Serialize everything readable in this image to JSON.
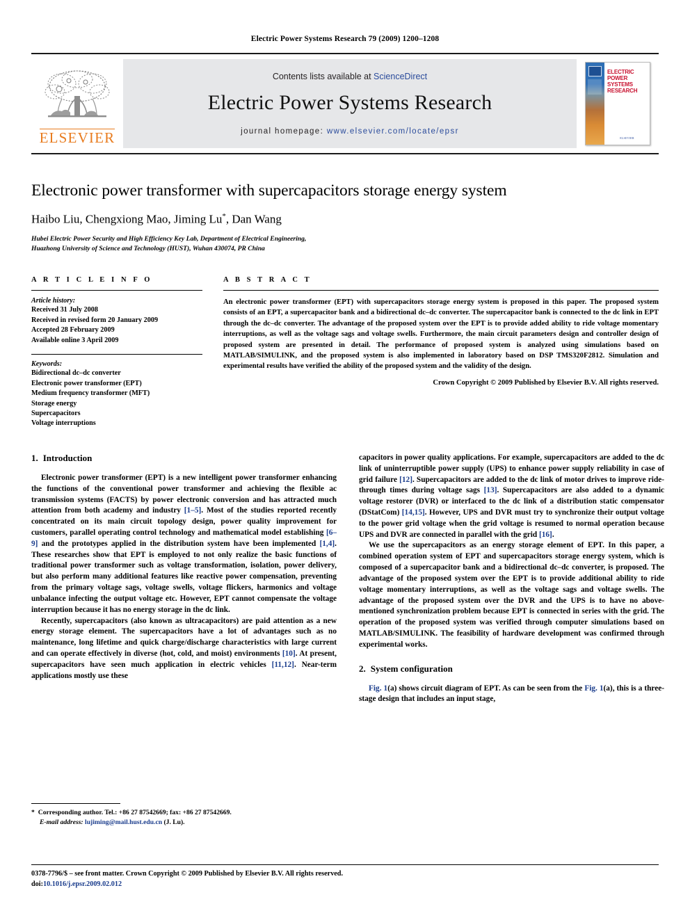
{
  "running_head": "Electric Power Systems Research 79 (2009) 1200–1208",
  "masthead": {
    "contents_prefix": "Contents lists available at ",
    "contents_link": "ScienceDirect",
    "journal_name": "Electric Power Systems Research",
    "homepage_label": "journal homepage:",
    "homepage_url": "www.elsevier.com/locate/epsr",
    "publisher_wordmark": "ELSEVIER",
    "publisher_color": "#E87B1E",
    "link_color": "#2a4b9b",
    "panel_color": "#e6e7e9",
    "cover": {
      "title_line1": "ELECTRIC POWER",
      "title_line2": "SYSTEMS RESEARCH",
      "title_color": "#c8102e",
      "footer_text": "ELSEVIER"
    }
  },
  "article": {
    "title": "Electronic power transformer with supercapacitors storage energy system",
    "authors": "Haibo Liu, Chengxiong Mao, Jiming Lu",
    "authors_suffix": ", Dan Wang",
    "corresponding_marker": "*",
    "affiliation_line1": "Hubei Electric Power Security and High Efficiency Key Lab, Department of Electrical Engineering,",
    "affiliation_line2": "Huazhong University of Science and Technology (HUST), Wuhan 430074, PR China"
  },
  "article_info": {
    "section_label": "A R T I C L E   I N F O",
    "history_title": "Article history:",
    "history": [
      "Received 31 July 2008",
      "Received in revised form 20 January 2009",
      "Accepted 28 February 2009",
      "Available online 3 April 2009"
    ],
    "keywords_title": "Keywords:",
    "keywords": [
      "Bidirectional dc–dc converter",
      "Electronic power transformer (EPT)",
      "Medium frequency transformer (MFT)",
      "Storage energy",
      "Supercapacitors",
      "Voltage interruptions"
    ]
  },
  "abstract": {
    "section_label": "A B S T R A C T",
    "text": "An electronic power transformer (EPT) with supercapacitors storage energy system is proposed in this paper. The proposed system consists of an EPT, a supercapacitor bank and a bidirectional dc–dc converter. The supercapacitor bank is connected to the dc link in EPT through the dc–dc converter. The advantage of the proposed system over the EPT is to provide added ability to ride voltage momentary interruptions, as well as the voltage sags and voltage swells. Furthermore, the main circuit parameters design and controller design of proposed system are presented in detail. The performance of proposed system is analyzed using simulations based on MATLAB/SIMULINK, and the proposed system is also implemented in laboratory based on DSP TMS320F2812. Simulation and experimental results have verified the ability of the proposed system and the validity of the design.",
    "copyright": "Crown Copyright © 2009 Published by Elsevier B.V. All rights reserved."
  },
  "sections": {
    "intro": {
      "number": "1.",
      "title": "Introduction",
      "paragraphs": [
        "Electronic power transformer (EPT) is a new intelligent power transformer enhancing the functions of the conventional power transformer and achieving the flexible ac transmission systems (FACTS) by power electronic conversion and has attracted much attention from both academy and industry [1–5]. Most of the studies reported recently concentrated on its main circuit topology design, power quality improvement for customers, parallel operating control technology and mathematical model establishing [6–9] and the prototypes applied in the distribution system have been implemented [1,4]. These researches show that EPT is employed to not only realize the basic functions of traditional power transformer such as voltage transformation, isolation, power delivery, but also perform many additional features like reactive power compensation, preventing from the primary voltage sags, voltage swells, voltage flickers, harmonics and voltage unbalance infecting the output voltage etc. However, EPT cannot compensate the voltage interruption because it has no energy storage in the dc link.",
        "Recently, supercapacitors (also known as ultracapacitors) are paid attention as a new energy storage element. The supercapacitors have a lot of advantages such as no maintenance, long lifetime and quick charge/discharge characteristics with large current and can operate effectively in diverse (hot, cold, and moist) environments [10]. At present, supercapacitors have seen much application in electric vehicles [11,12]. Near-term applications mostly use these",
        "capacitors in power quality applications. For example, supercapacitors are added to the dc link of uninterruptible power supply (UPS) to enhance power supply reliability in case of grid failure [12]. Supercapacitors are added to the dc link of motor drives to improve ride-through times during voltage sags [13]. Supercapacitors are also added to a dynamic voltage restorer (DVR) or interfaced to the dc link of a distribution static compensator (DStatCom) [14,15]. However, UPS and DVR must try to synchronize their output voltage to the power grid voltage when the grid voltage is resumed to normal operation because UPS and DVR are connected in parallel with the grid [16].",
        "We use the supercapacitors as an energy storage element of EPT. In this paper, a combined operation system of EPT and supercapacitors storage energy system, which is composed of a supercapacitor bank and a bidirectional dc–dc converter, is proposed. The advantage of the proposed system over the EPT is to provide additional ability to ride voltage momentary interruptions, as well as the voltage sags and voltage swells. The advantage of the proposed system over the DVR and the UPS is to have no above-mentioned synchronization problem because EPT is connected in series with the grid. The operation of the proposed system was verified through computer simulations based on MATLAB/SIMULINK. The feasibility of hardware development was confirmed through experimental works."
      ]
    },
    "system_config": {
      "number": "2.",
      "title": "System configuration",
      "paragraph": "Fig. 1(a) shows circuit diagram of EPT. As can be seen from the Fig. 1(a), this is a three-stage design that includes an input stage,"
    }
  },
  "footnote": {
    "marker": "*",
    "text": "Corresponding author. Tel.: +86 27 87542669; fax: +86 27 87542669.",
    "email_label": "E-mail address:",
    "email": "lujiming@mail.hust.edu.cn",
    "email_owner": "(J. Lu)."
  },
  "page_footer": {
    "front_matter": "0378-7796/$ – see front matter. Crown Copyright © 2009 Published by Elsevier B.V. All rights reserved.",
    "doi_label": "doi:",
    "doi": "10.1016/j.epsr.2009.02.012"
  }
}
